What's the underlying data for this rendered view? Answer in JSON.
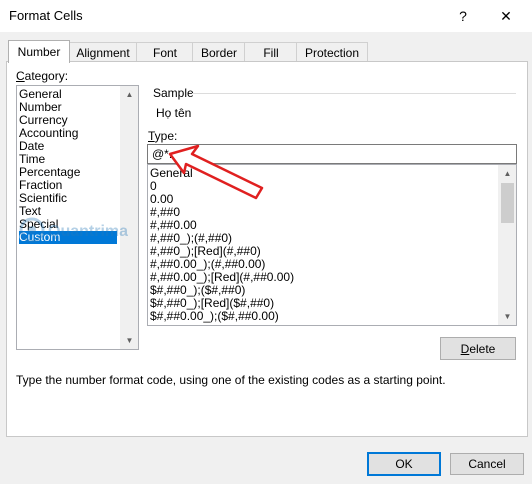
{
  "window": {
    "title": "Format Cells",
    "help_glyph": "?",
    "close_glyph": "✕"
  },
  "tabs": [
    {
      "label": "Number"
    },
    {
      "label": "Alignment"
    },
    {
      "label": "Font"
    },
    {
      "label": "Border"
    },
    {
      "label": "Fill"
    },
    {
      "label": "Protection"
    }
  ],
  "category": {
    "label": "Category:",
    "items": [
      "General",
      "Number",
      "Currency",
      "Accounting",
      "Date",
      "Time",
      "Percentage",
      "Fraction",
      "Scientific",
      "Text",
      "Special",
      "Custom"
    ],
    "selected": "Custom"
  },
  "sample": {
    "label": "Sample",
    "value": "Họ tên"
  },
  "type": {
    "label": "Type:",
    "value": "@*.",
    "formats": [
      "General",
      "0",
      "0.00",
      "#,##0",
      "#,##0.00",
      "#,##0_);(#,##0)",
      "#,##0_);[Red](#,##0)",
      "#,##0.00_);(#,##0.00)",
      "#,##0.00_);[Red](#,##0.00)",
      "$#,##0_);($#,##0)",
      "$#,##0_);[Red]($#,##0)",
      "$#,##0.00_);($#,##0.00)"
    ]
  },
  "buttons": {
    "delete": "Delete",
    "ok": "OK",
    "cancel": "Cancel"
  },
  "hint": "Type the number format code, using one of the existing codes as a starting point.",
  "watermark": "Quantrimang",
  "colors": {
    "selection": "#0078d7",
    "annotation_arrow": "#e02020"
  }
}
